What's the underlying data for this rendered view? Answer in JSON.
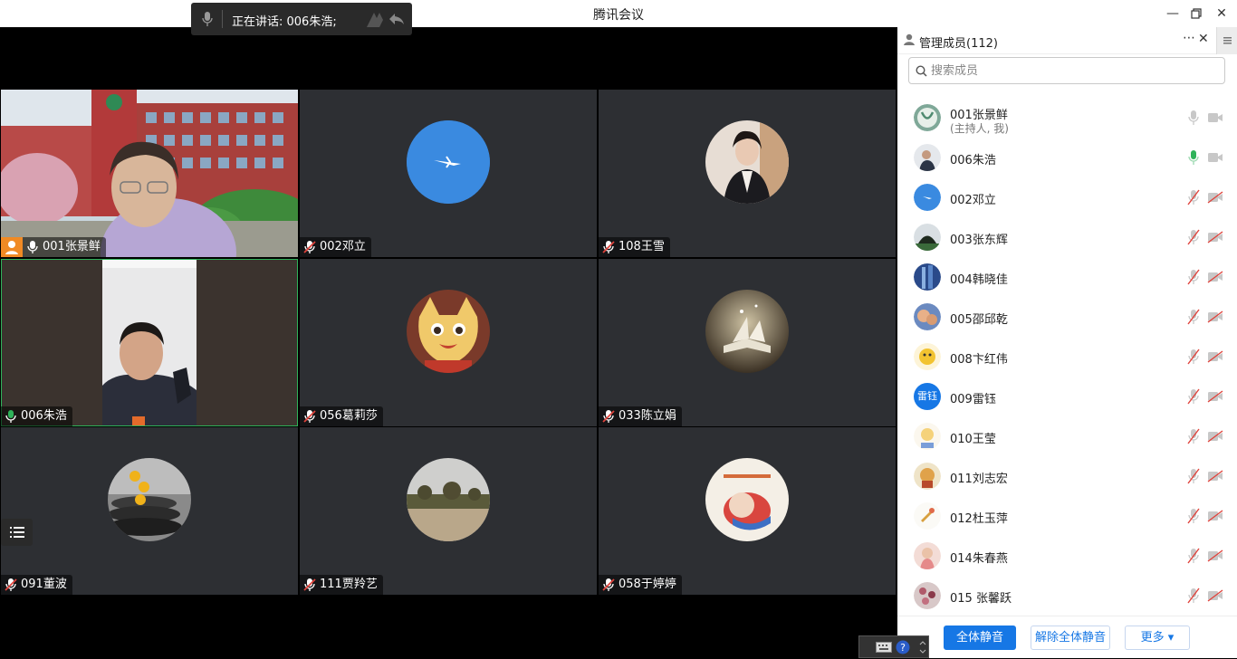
{
  "window": {
    "title": "腾讯会议"
  },
  "speaking": {
    "text": "正在讲话: 006朱浩;"
  },
  "tiles": [
    {
      "name": "001张景鲜",
      "mic": "on",
      "host": true,
      "kind": "video-school"
    },
    {
      "name": "002邓立",
      "mic": "muted",
      "kind": "avatar-sky"
    },
    {
      "name": "108王雪",
      "mic": "muted",
      "kind": "avatar-woman"
    },
    {
      "name": "006朱浩",
      "mic": "speaking",
      "active": true,
      "kind": "video-man"
    },
    {
      "name": "056葛莉莎",
      "mic": "muted",
      "kind": "avatar-cat"
    },
    {
      "name": "033陈立娟",
      "mic": "muted",
      "kind": "avatar-book"
    },
    {
      "name": "091董波",
      "mic": "muted",
      "kind": "avatar-flower"
    },
    {
      "name": "111贾羚艺",
      "mic": "muted",
      "kind": "avatar-field"
    },
    {
      "name": "058于婷婷",
      "mic": "muted",
      "kind": "avatar-cartoon"
    }
  ],
  "panel": {
    "title": "管理成员(112)",
    "search_placeholder": "搜索成员",
    "members": [
      {
        "name": "001张景鲜",
        "sub": "(主持人, 我)",
        "mic": "on",
        "cam": "on",
        "avatar": "logo"
      },
      {
        "name": "006朱浩",
        "mic": "speaking",
        "cam": "on",
        "avatar": "photo"
      },
      {
        "name": "002邓立",
        "mic": "muted",
        "cam": "off",
        "avatar": "sky"
      },
      {
        "name": "003张东辉",
        "mic": "muted",
        "cam": "off",
        "avatar": "photo"
      },
      {
        "name": "004韩晓佳",
        "mic": "muted",
        "cam": "off",
        "avatar": "photo"
      },
      {
        "name": "005邵邱乾",
        "mic": "muted",
        "cam": "off",
        "avatar": "photo"
      },
      {
        "name": "008卞红伟",
        "mic": "muted",
        "cam": "off",
        "avatar": "cartoon"
      },
      {
        "name": "009雷钰",
        "mic": "muted",
        "cam": "off",
        "avatar": "text",
        "avatar_text": "雷钰"
      },
      {
        "name": "010王莹",
        "mic": "muted",
        "cam": "off",
        "avatar": "cartoon"
      },
      {
        "name": "011刘志宏",
        "mic": "muted",
        "cam": "off",
        "avatar": "cartoon"
      },
      {
        "name": "012杜玉萍",
        "mic": "muted",
        "cam": "off",
        "avatar": "cartoon"
      },
      {
        "name": "014朱春燕",
        "mic": "muted",
        "cam": "off",
        "avatar": "photo"
      },
      {
        "name": "015 张馨跃",
        "mic": "muted",
        "cam": "off",
        "avatar": "photo"
      }
    ],
    "footer": {
      "mute_all": "全体静音",
      "unmute_all": "解除全体静音",
      "more": "更多 ▾"
    }
  },
  "colors": {
    "accent": "#1677e5",
    "speaking_green": "#2fb35a",
    "muted_red": "#e0433c",
    "host_orange": "#f08a24"
  }
}
